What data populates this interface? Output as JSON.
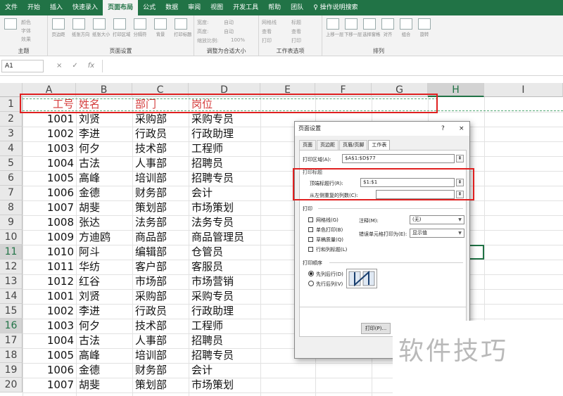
{
  "ribbon_tabs": [
    "文件",
    "开始",
    "插入",
    "快速录入",
    "页面布局",
    "公式",
    "数据",
    "审阅",
    "视图",
    "开发工具",
    "帮助",
    "团队"
  ],
  "active_tab": "页面布局",
  "tell_me": "操作说明搜索",
  "ribbon": {
    "theme": {
      "items": [
        "颜色",
        "字体",
        "效果"
      ],
      "label": "主题"
    },
    "page_setup": {
      "buttons": [
        "页边距",
        "纸张方向",
        "纸张大小",
        "打印区域",
        "分隔符",
        "背景",
        "打印标题"
      ],
      "label": "页面设置"
    },
    "scale": {
      "width": "宽度:",
      "width_val": "自动",
      "height": "高度:",
      "height_val": "自动",
      "scale": "缩放比例:",
      "scale_val": "100%",
      "label": "调整为合适大小"
    },
    "sheet_options": {
      "gridlines": "网格线",
      "headings": "标题",
      "view": "查看",
      "print": "打印",
      "label": "工作表选项"
    },
    "arrange": {
      "buttons": [
        "上移一层",
        "下移一层",
        "选择窗格",
        "对齐",
        "组合",
        "旋转"
      ],
      "label": "排列"
    }
  },
  "formula_bar": {
    "name_box": "A1",
    "cancel": "×",
    "enter": "✓",
    "fx": "fx"
  },
  "columns": [
    "A",
    "B",
    "C",
    "D",
    "E",
    "F",
    "G",
    "H",
    "I"
  ],
  "selected_col": "H",
  "rows": [
    [
      "工号",
      "姓名",
      "部门",
      "岗位"
    ],
    [
      "1001",
      "刘贤",
      "采购部",
      "采购专员"
    ],
    [
      "1002",
      "李进",
      "行政员",
      "行政助理"
    ],
    [
      "1003",
      "何夕",
      "技术部",
      "工程师"
    ],
    [
      "1004",
      "古法",
      "人事部",
      "招聘员"
    ],
    [
      "1005",
      "高峰",
      "培训部",
      "招聘专员"
    ],
    [
      "1006",
      "金德",
      "财务部",
      "会计"
    ],
    [
      "1007",
      "胡斐",
      "策划部",
      "市场策划"
    ],
    [
      "1008",
      "张达",
      "法务部",
      "法务专员"
    ],
    [
      "1009",
      "方迪鸥",
      "商品部",
      "商品管理员"
    ],
    [
      "1010",
      "阿斗",
      "编辑部",
      "仓管员"
    ],
    [
      "1011",
      "华纺",
      "客户部",
      "客服员"
    ],
    [
      "1012",
      "红谷",
      "市场部",
      "市场营销"
    ],
    [
      "1001",
      "刘贤",
      "采购部",
      "采购专员"
    ],
    [
      "1002",
      "李进",
      "行政员",
      "行政助理"
    ],
    [
      "1003",
      "何夕",
      "技术部",
      "工程师"
    ],
    [
      "1004",
      "古法",
      "人事部",
      "招聘员"
    ],
    [
      "1005",
      "高峰",
      "培训部",
      "招聘专员"
    ],
    [
      "1006",
      "金德",
      "财务部",
      "会计"
    ],
    [
      "1007",
      "胡斐",
      "策划部",
      "市场策划"
    ]
  ],
  "selected_rows": [
    11,
    16
  ],
  "dialog": {
    "title": "页面设置",
    "help": "?",
    "close": "×",
    "tabs": [
      "页面",
      "页边距",
      "页眉/页脚",
      "工作表"
    ],
    "active_tab": "工作表",
    "print_area_label": "打印区域(A):",
    "print_area_value": "$A$1:$D$77",
    "print_titles_label": "打印标题",
    "top_rows_label": "顶端标题行(R):",
    "top_rows_value": "$1:$1",
    "left_cols_label": "从左侧重复的列数(C):",
    "left_cols_value": "",
    "print_section": "打印",
    "checks": [
      {
        "label": "网格线(G)",
        "checked": false
      },
      {
        "label": "单色打印(B)",
        "checked": false
      },
      {
        "label": "草稿质量(Q)",
        "checked": false
      },
      {
        "label": "行和列标题(L)",
        "checked": false
      }
    ],
    "comments_label": "注释(M):",
    "comments_value": "(无)",
    "errors_label": "错误单元格打印为(E):",
    "errors_value": "显示值",
    "order_section": "打印顺序",
    "order_options": [
      {
        "label": "先列后行(D)",
        "selected": true
      },
      {
        "label": "先行后列(V)",
        "selected": false
      }
    ],
    "print_button": "打印(P)..."
  },
  "watermark": "软件技巧"
}
